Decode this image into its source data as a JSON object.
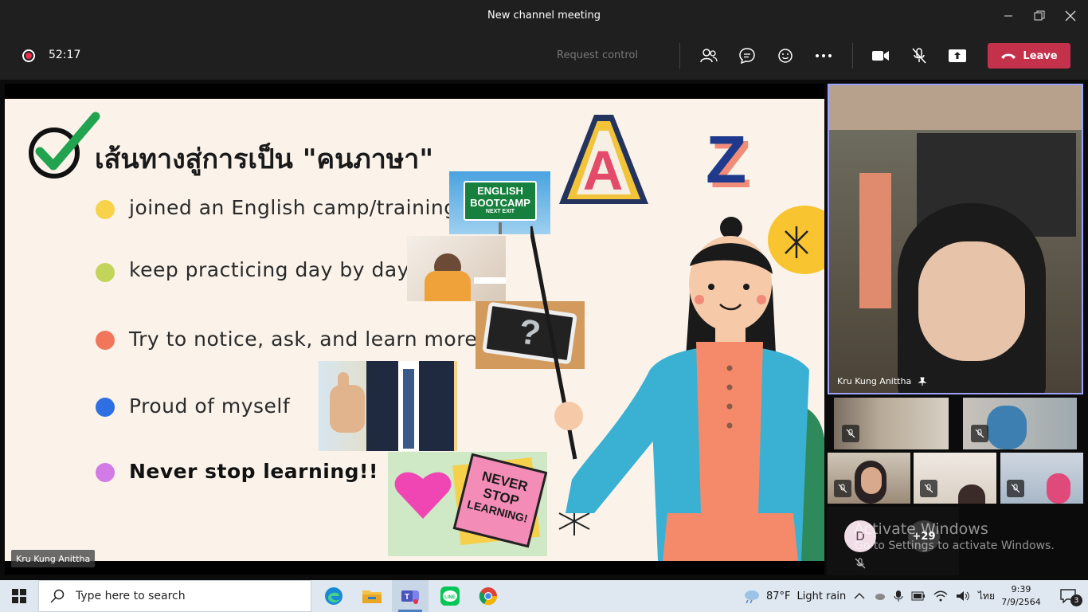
{
  "window": {
    "title": "New channel meeting"
  },
  "controls": {
    "timer": "52:17",
    "request_control": "Request control",
    "leave_label": "Leave"
  },
  "slide": {
    "title": "เส้นทางสู่การเป็น \"คนภาษา\"",
    "bullets": [
      {
        "text": "joined an English camp/training",
        "color": "#f7d24a"
      },
      {
        "text": "keep practicing day by day",
        "color": "#c3d45a"
      },
      {
        "text": "Try to notice, ask, and learn more",
        "color": "#f2775a"
      },
      {
        "text": "Proud of myself",
        "color": "#2f6fe4"
      },
      {
        "text": "Never stop learning!!",
        "color": "#d27ae6"
      }
    ],
    "sign_line1": "ENGLISH",
    "sign_line2": "BOOTCAMP",
    "sign_line3": "NEXT EXIT",
    "note_line1": "NEVER",
    "note_line2": "STOP",
    "note_line3": "LEARNING!",
    "letter_a": "A",
    "letter_z": "Z"
  },
  "stage": {
    "presenter_name": "Kru Kung Anittha"
  },
  "pinned": {
    "name": "Kru Kung Anittha"
  },
  "overflow": {
    "avatar_initial": "D",
    "more_count": "+29"
  },
  "watermark": {
    "line1": "Activate Windows",
    "line2": "Go to Settings to activate Windows."
  },
  "taskbar": {
    "search_placeholder": "Type here to search",
    "weather_temp": "87°F",
    "weather_desc": "Light rain",
    "language": "ไทย",
    "time": "9:39",
    "date": "7/9/2564",
    "notification_count": "3"
  },
  "colors": {
    "leave": "#c4314b",
    "accent": "#9ea2ff",
    "slide_bg": "#fbf3ea"
  }
}
